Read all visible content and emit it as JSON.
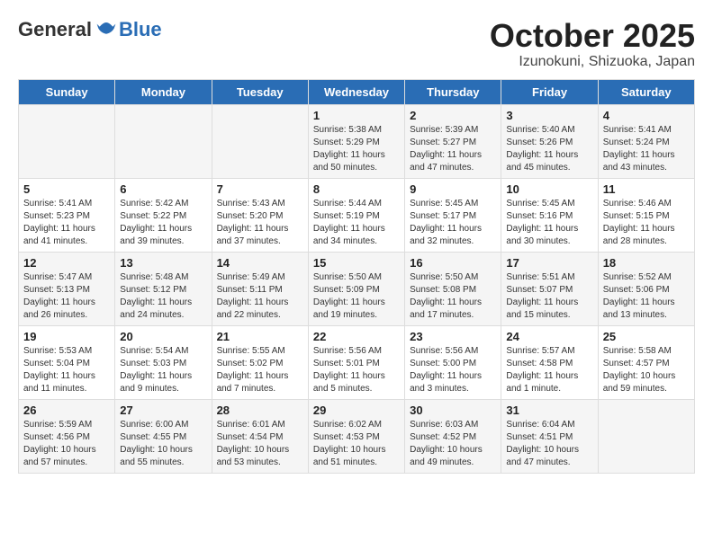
{
  "header": {
    "logo_general": "General",
    "logo_blue": "Blue",
    "month_title": "October 2025",
    "subtitle": "Izunokuni, Shizuoka, Japan"
  },
  "days_of_week": [
    "Sunday",
    "Monday",
    "Tuesday",
    "Wednesday",
    "Thursday",
    "Friday",
    "Saturday"
  ],
  "weeks": [
    [
      {
        "day": "",
        "content": ""
      },
      {
        "day": "",
        "content": ""
      },
      {
        "day": "",
        "content": ""
      },
      {
        "day": "1",
        "content": "Sunrise: 5:38 AM\nSunset: 5:29 PM\nDaylight: 11 hours\nand 50 minutes."
      },
      {
        "day": "2",
        "content": "Sunrise: 5:39 AM\nSunset: 5:27 PM\nDaylight: 11 hours\nand 47 minutes."
      },
      {
        "day": "3",
        "content": "Sunrise: 5:40 AM\nSunset: 5:26 PM\nDaylight: 11 hours\nand 45 minutes."
      },
      {
        "day": "4",
        "content": "Sunrise: 5:41 AM\nSunset: 5:24 PM\nDaylight: 11 hours\nand 43 minutes."
      }
    ],
    [
      {
        "day": "5",
        "content": "Sunrise: 5:41 AM\nSunset: 5:23 PM\nDaylight: 11 hours\nand 41 minutes."
      },
      {
        "day": "6",
        "content": "Sunrise: 5:42 AM\nSunset: 5:22 PM\nDaylight: 11 hours\nand 39 minutes."
      },
      {
        "day": "7",
        "content": "Sunrise: 5:43 AM\nSunset: 5:20 PM\nDaylight: 11 hours\nand 37 minutes."
      },
      {
        "day": "8",
        "content": "Sunrise: 5:44 AM\nSunset: 5:19 PM\nDaylight: 11 hours\nand 34 minutes."
      },
      {
        "day": "9",
        "content": "Sunrise: 5:45 AM\nSunset: 5:17 PM\nDaylight: 11 hours\nand 32 minutes."
      },
      {
        "day": "10",
        "content": "Sunrise: 5:45 AM\nSunset: 5:16 PM\nDaylight: 11 hours\nand 30 minutes."
      },
      {
        "day": "11",
        "content": "Sunrise: 5:46 AM\nSunset: 5:15 PM\nDaylight: 11 hours\nand 28 minutes."
      }
    ],
    [
      {
        "day": "12",
        "content": "Sunrise: 5:47 AM\nSunset: 5:13 PM\nDaylight: 11 hours\nand 26 minutes."
      },
      {
        "day": "13",
        "content": "Sunrise: 5:48 AM\nSunset: 5:12 PM\nDaylight: 11 hours\nand 24 minutes."
      },
      {
        "day": "14",
        "content": "Sunrise: 5:49 AM\nSunset: 5:11 PM\nDaylight: 11 hours\nand 22 minutes."
      },
      {
        "day": "15",
        "content": "Sunrise: 5:50 AM\nSunset: 5:09 PM\nDaylight: 11 hours\nand 19 minutes."
      },
      {
        "day": "16",
        "content": "Sunrise: 5:50 AM\nSunset: 5:08 PM\nDaylight: 11 hours\nand 17 minutes."
      },
      {
        "day": "17",
        "content": "Sunrise: 5:51 AM\nSunset: 5:07 PM\nDaylight: 11 hours\nand 15 minutes."
      },
      {
        "day": "18",
        "content": "Sunrise: 5:52 AM\nSunset: 5:06 PM\nDaylight: 11 hours\nand 13 minutes."
      }
    ],
    [
      {
        "day": "19",
        "content": "Sunrise: 5:53 AM\nSunset: 5:04 PM\nDaylight: 11 hours\nand 11 minutes."
      },
      {
        "day": "20",
        "content": "Sunrise: 5:54 AM\nSunset: 5:03 PM\nDaylight: 11 hours\nand 9 minutes."
      },
      {
        "day": "21",
        "content": "Sunrise: 5:55 AM\nSunset: 5:02 PM\nDaylight: 11 hours\nand 7 minutes."
      },
      {
        "day": "22",
        "content": "Sunrise: 5:56 AM\nSunset: 5:01 PM\nDaylight: 11 hours\nand 5 minutes."
      },
      {
        "day": "23",
        "content": "Sunrise: 5:56 AM\nSunset: 5:00 PM\nDaylight: 11 hours\nand 3 minutes."
      },
      {
        "day": "24",
        "content": "Sunrise: 5:57 AM\nSunset: 4:58 PM\nDaylight: 11 hours\nand 1 minute."
      },
      {
        "day": "25",
        "content": "Sunrise: 5:58 AM\nSunset: 4:57 PM\nDaylight: 10 hours\nand 59 minutes."
      }
    ],
    [
      {
        "day": "26",
        "content": "Sunrise: 5:59 AM\nSunset: 4:56 PM\nDaylight: 10 hours\nand 57 minutes."
      },
      {
        "day": "27",
        "content": "Sunrise: 6:00 AM\nSunset: 4:55 PM\nDaylight: 10 hours\nand 55 minutes."
      },
      {
        "day": "28",
        "content": "Sunrise: 6:01 AM\nSunset: 4:54 PM\nDaylight: 10 hours\nand 53 minutes."
      },
      {
        "day": "29",
        "content": "Sunrise: 6:02 AM\nSunset: 4:53 PM\nDaylight: 10 hours\nand 51 minutes."
      },
      {
        "day": "30",
        "content": "Sunrise: 6:03 AM\nSunset: 4:52 PM\nDaylight: 10 hours\nand 49 minutes."
      },
      {
        "day": "31",
        "content": "Sunrise: 6:04 AM\nSunset: 4:51 PM\nDaylight: 10 hours\nand 47 minutes."
      },
      {
        "day": "",
        "content": ""
      }
    ]
  ]
}
